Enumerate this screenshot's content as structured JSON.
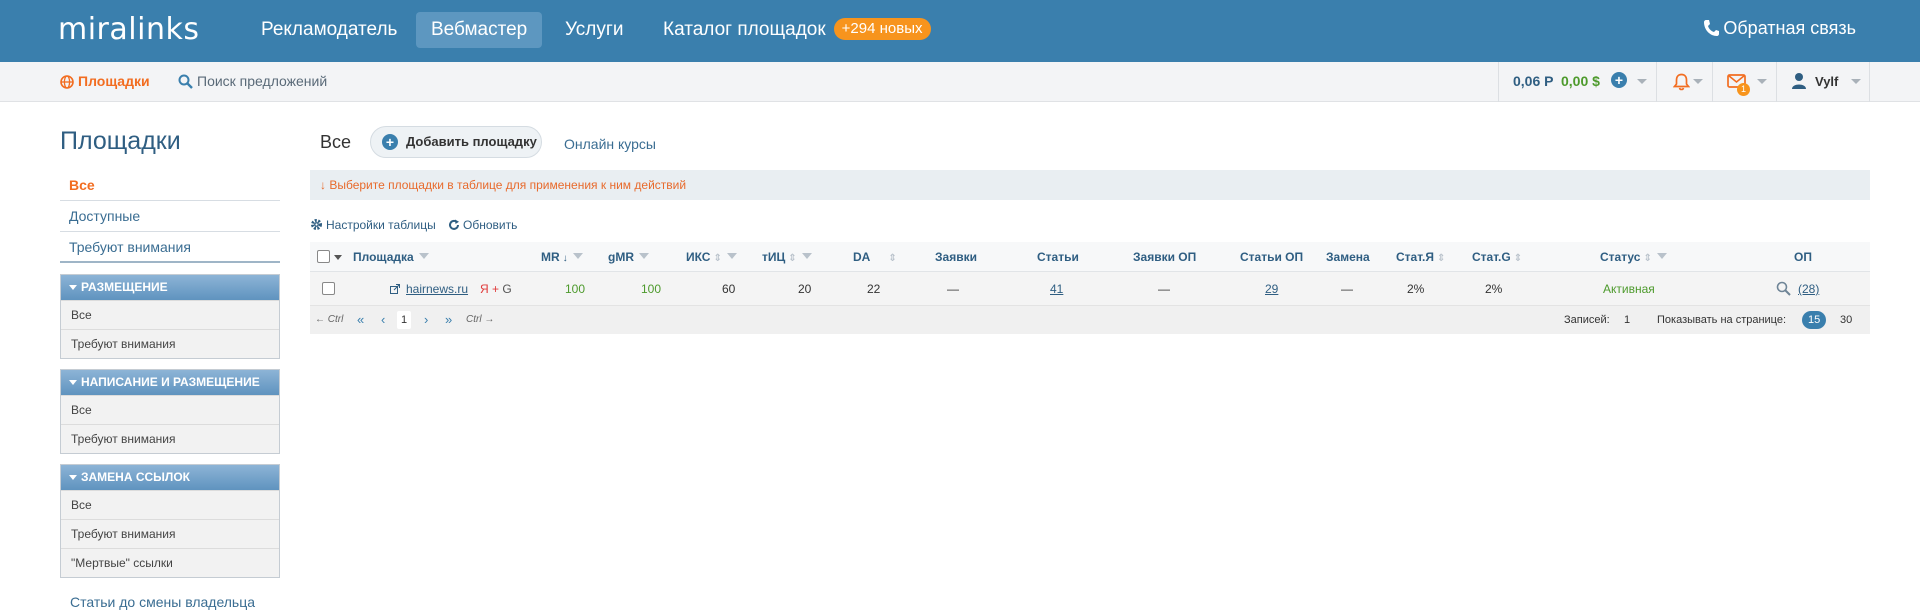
{
  "header": {
    "logo": "miralinks",
    "nav": [
      "Рекламодатель",
      "Вебмастер",
      "Услуги",
      "Каталог площадок"
    ],
    "catalog_badge": "+294 новых",
    "feedback": "Обратная связь"
  },
  "subbar": {
    "places": "Площадки",
    "search": "Поиск предложений",
    "balance_rub": "0,06 Р",
    "balance_usd": "0,00 $",
    "mail_count": "1",
    "user": "Vylf"
  },
  "sidebar": {
    "title": "Площадки",
    "items": [
      "Все",
      "Доступные",
      "Требуют внимания"
    ],
    "groups": [
      {
        "title": "РАЗМЕЩЕНИЕ",
        "items": [
          "Все",
          "Требуют внимания"
        ]
      },
      {
        "title": "НАПИСАНИЕ И РАЗМЕЩЕНИЕ",
        "items": [
          "Все",
          "Требуют внимания"
        ]
      },
      {
        "title": "ЗАМЕНА ССЫЛОК",
        "items": [
          "Все",
          "Требуют внимания",
          "\"Мертвые\" ссылки"
        ]
      }
    ],
    "footer": "Статьи до смены владельца"
  },
  "main": {
    "tab_all": "Все",
    "add_button": "Добавить площадку",
    "courses": "Онлайн курсы",
    "notice": "↓  Выберите площадки в таблице для применения к ним действий",
    "table_settings": "Настройки таблицы",
    "refresh": "Обновить"
  },
  "table": {
    "headers": {
      "site": "Площадка",
      "mr": "MR",
      "gmr": "gMR",
      "iks": "ИКС",
      "tic": "тИЦ",
      "da": "DA",
      "requests": "Заявки",
      "articles": "Статьи",
      "requests_op": "Заявки ОП",
      "articles_op": "Статьи ОП",
      "replace": "Замена",
      "stat_y": "Стат.Я",
      "stat_g": "Стат.G",
      "status": "Статус",
      "op": "ОП"
    },
    "rows": [
      {
        "site": "hairnews.ru",
        "engine_y": "Я",
        "engine_plus": "+",
        "engine_g": "G",
        "mr": "100",
        "gmr": "100",
        "iks": "60",
        "tic": "20",
        "da": "22",
        "requests": "—",
        "articles": "41",
        "requests_op": "—",
        "articles_op": "29",
        "replace": "—",
        "stat_y": "2%",
        "stat_g": "2%",
        "status": "Активная",
        "op": "(28)"
      }
    ]
  },
  "pager": {
    "prev_ctrl": "← Ctrl",
    "first": "«",
    "prev": "‹",
    "page": "1",
    "next": "›",
    "last": "»",
    "next_ctrl": "Ctrl →",
    "records_label": "Записей:",
    "records": "1",
    "per_page_label": "Показывать на странице:",
    "per_page_selected": "15",
    "per_page_other": "30"
  },
  "colors": {
    "brand": "#3a7fad",
    "accent": "#f26d21",
    "green": "#4d9a2c"
  }
}
